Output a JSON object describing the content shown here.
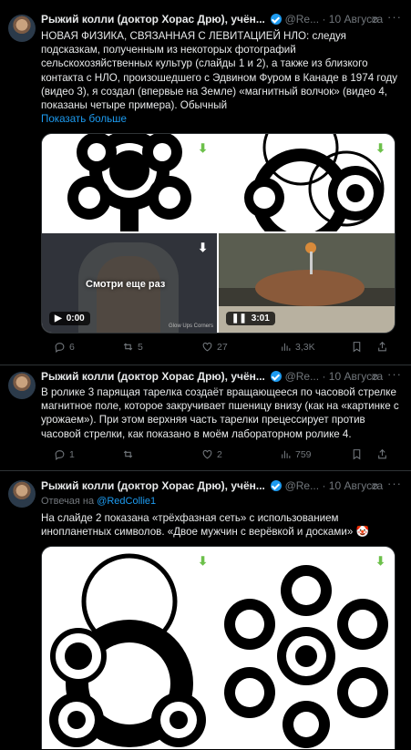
{
  "tweets": [
    {
      "author": "Рыжий колли (доктор Хорас Дрю), учён...",
      "handle": "@Re...",
      "date": "10 Августа",
      "text": "НОВАЯ ФИЗИКА, СВЯЗАННАЯ С ЛЕВИТАЦИЕЙ НЛО: следуя подсказкам, полученным из некоторых фотографий сельскохозяйственных культур (слайды 1 и 2), а также из близкого контакта с НЛО, произошедшего с Эдвином Фуром в Канаде в 1974 году (видео 3), я создал (впервые на Земле) «магнитный волчок» (видео 4, показаны четыре примера).",
      "text_extra": "Обычный",
      "show_more": "Показать больше",
      "video1": {
        "overlay": "Смотри еще раз",
        "time": "0:00",
        "watermark": "Glow Ups Corners"
      },
      "video2": {
        "time": "3:01"
      },
      "replies": "6",
      "reposts": "5",
      "likes": "27",
      "views": "3,3K"
    },
    {
      "author": "Рыжий колли (доктор Хорас Дрю), учён...",
      "handle": "@Re...",
      "date": "10 Августа",
      "text": "В ролике 3 парящая тарелка создаёт вращающееся по часовой стрелке магнитное поле, которое закручивает пшеницу внизу (как на «картинке с урожаем»). При этом верхняя часть тарелки прецессирует против часовой стрелки, как показано в моём лабораторном ролике 4.",
      "replies": "1",
      "reposts": "",
      "likes": "2",
      "views": "759"
    },
    {
      "author": "Рыжий колли (доктор Хорас Дрю), учён...",
      "handle": "@Re...",
      "date": "10 Августа",
      "reply_label": "Отвечая на",
      "reply_to": "@RedCollie1",
      "text": "На слайде 2 показана «трёхфазная сеть» с использованием инопланетных символов. «Двое мужчин с верёвкой и досками» 🤡"
    }
  ],
  "icons": {
    "reply": "reply-icon",
    "repost": "repost-icon",
    "like": "like-icon",
    "views": "views-icon",
    "bookmark": "bookmark-icon",
    "share": "share-icon",
    "download": "download-icon",
    "grok": "grok-icon",
    "more": "more-icon"
  },
  "colors": {
    "link": "#1d9bf0",
    "muted": "#71767b",
    "download": "#6cc04a"
  }
}
